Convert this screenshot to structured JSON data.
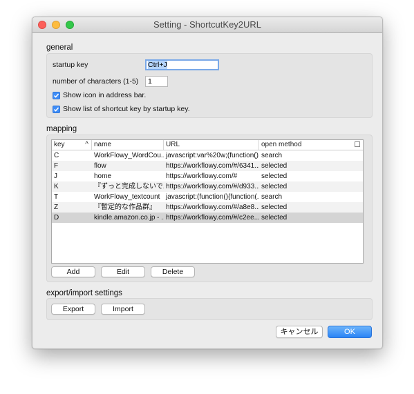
{
  "window": {
    "title": "Setting - ShortcutKey2URL"
  },
  "general": {
    "heading": "general",
    "startup_key_label": "startup key",
    "startup_key_value": "Ctrl+J",
    "num_chars_label": "number of characters (1-5)",
    "num_chars_value": "1",
    "show_icon_label": "Show icon in address bar.",
    "show_icon_checked": true,
    "show_list_label": "Show list of shortcut key by startup key.",
    "show_list_checked": true
  },
  "mapping": {
    "heading": "mapping",
    "columns": [
      "key",
      "name",
      "URL",
      "open method"
    ],
    "sort_indicator": "^",
    "rows": [
      {
        "key": "C",
        "name": "WorkFlowy_WordCou...",
        "url": "javascript:var%20w;(function()...",
        "method": "search"
      },
      {
        "key": "F",
        "name": "flow",
        "url": "https://workflowy.com/#/6341...",
        "method": "selected"
      },
      {
        "key": "J",
        "name": "home",
        "url": "https://workflowy.com/#",
        "method": "selected"
      },
      {
        "key": "K",
        "name": "『ずっと完成しないで...",
        "url": "https://workflowy.com/#/d933...",
        "method": "selected"
      },
      {
        "key": "T",
        "name": "WorkFlowy_textcount",
        "url": "javascript:(function(){function(...",
        "method": "search"
      },
      {
        "key": "Z",
        "name": "『暫定的な作品群』",
        "url": "https://workflowy.com/#/a8e8...",
        "method": "selected"
      },
      {
        "key": "D",
        "name": "kindle.amazon.co.jp - ...",
        "url": "https://workflowy.com/#/c2ee...",
        "method": "selected"
      }
    ],
    "selected_row": 6,
    "add_label": "Add",
    "edit_label": "Edit",
    "delete_label": "Delete"
  },
  "export_import": {
    "heading": "export/import settings",
    "export_label": "Export",
    "import_label": "Import"
  },
  "footer": {
    "cancel_label": "キャンセル",
    "ok_label": "OK"
  },
  "colors": {
    "accent": "#3f8df7",
    "selected_row": "#d4d4d4"
  }
}
